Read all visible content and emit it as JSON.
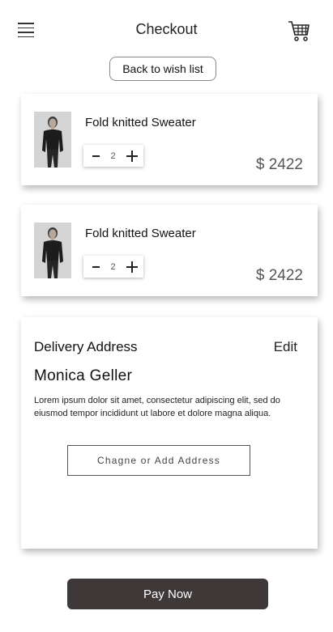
{
  "header": {
    "title": "Checkout",
    "menu_icon": "hamburger-menu-icon",
    "cart_icon": "shopping-cart-icon"
  },
  "back_button": {
    "label": "Back to wish list"
  },
  "cart_items": [
    {
      "name": "Fold knitted Sweater",
      "quantity": "2",
      "price": "$ 2422",
      "image": "sweater-model-photo"
    },
    {
      "name": "Fold knitted Sweater",
      "quantity": "2",
      "price": "$ 2422",
      "image": "sweater-model-photo"
    }
  ],
  "delivery": {
    "title": "Delivery Address",
    "edit_label": "Edit",
    "name": "Monica Geller",
    "address": "Lorem ipsum dolor sit amet, consectetur adipiscing elit, sed do eiusmod tempor incididunt ut labore et dolore magna aliqua.",
    "change_button_label": "Chagne or Add Address"
  },
  "pay_button": {
    "label": "Pay Now"
  },
  "colors": {
    "pay_button_bg": "#3e3838",
    "text_primary": "#111111",
    "price_text": "#555555"
  }
}
